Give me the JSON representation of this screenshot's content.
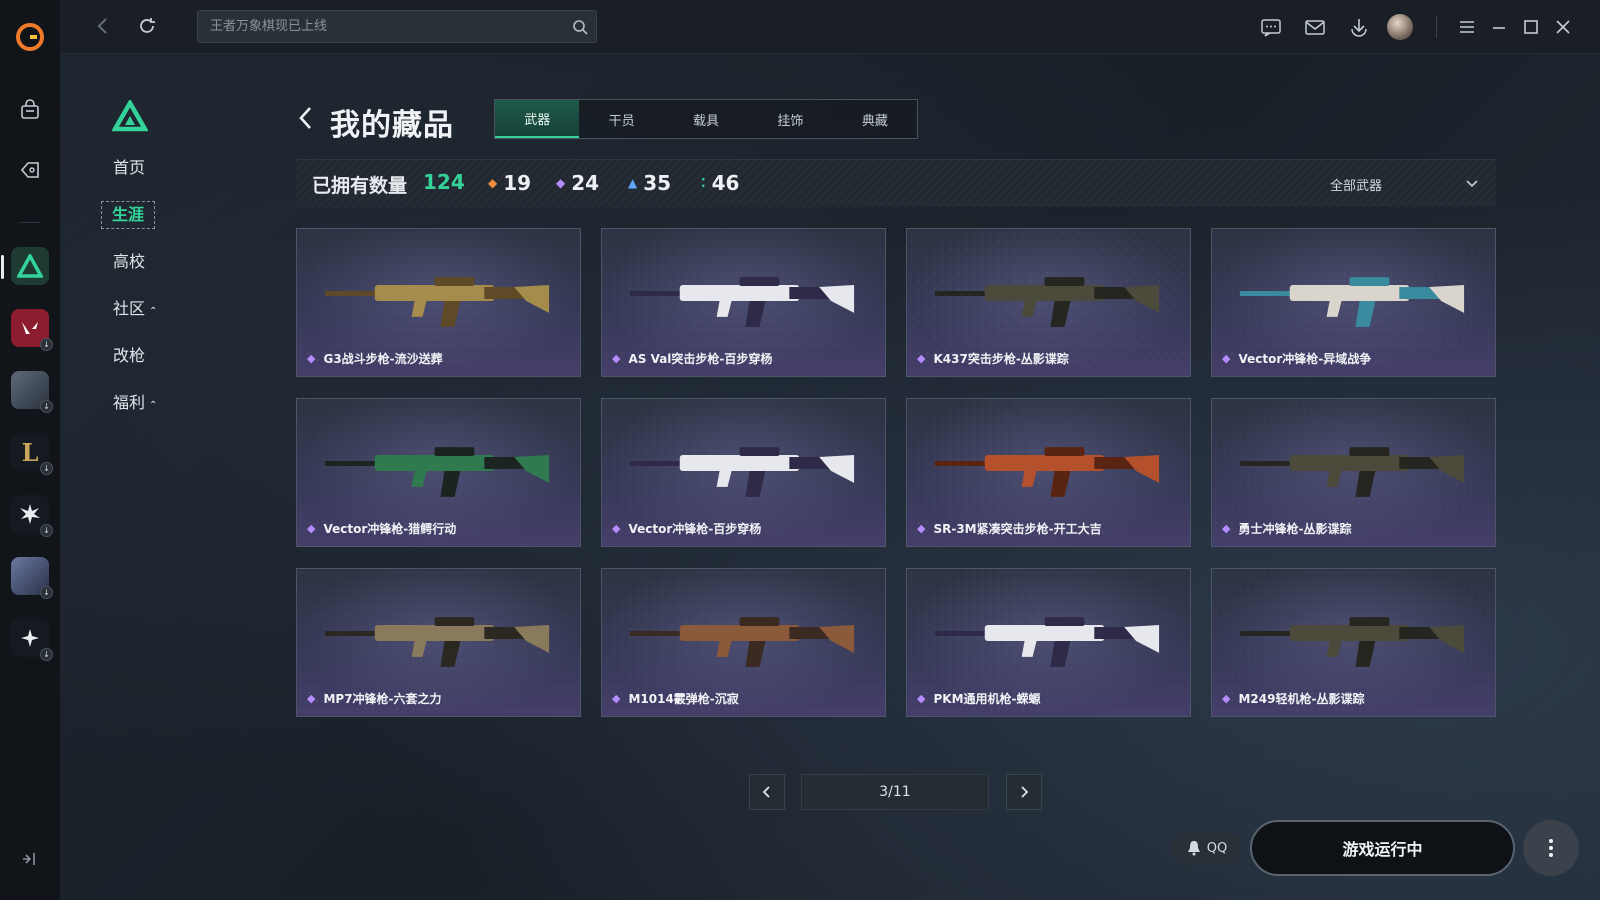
{
  "search": {
    "placeholder": "王者万象棋现已上线"
  },
  "subnav": {
    "items": [
      {
        "label": "首页",
        "caret": ""
      },
      {
        "label": "生涯",
        "caret": ""
      },
      {
        "label": "高校",
        "caret": ""
      },
      {
        "label": "社区",
        "caret": "⌃"
      },
      {
        "label": "改枪",
        "caret": ""
      },
      {
        "label": "福利",
        "caret": "⌃"
      }
    ]
  },
  "header": {
    "title": "我的藏品",
    "tabs": [
      "武器",
      "干员",
      "载具",
      "挂饰",
      "典藏"
    ]
  },
  "stats": {
    "owned_label": "已拥有数量",
    "owned_count": "124",
    "rarities": [
      {
        "value": "19",
        "color": "#f08a3c"
      },
      {
        "value": "24",
        "color": "#b58cff"
      },
      {
        "value": "35",
        "color": "#5ea8ff"
      },
      {
        "value": "46",
        "color": "#34d399"
      }
    ],
    "filter_label": "全部武器"
  },
  "items": [
    {
      "name": "G3战斗步枪-流沙送葬",
      "scheme": "gold"
    },
    {
      "name": "AS Val突击步枪-百步穿杨",
      "scheme": "white"
    },
    {
      "name": "K437突击步枪-丛影谍踪",
      "scheme": "camo"
    },
    {
      "name": "Vector冲锋枪-异域战争",
      "scheme": "ornate"
    },
    {
      "name": "Vector冲锋枪-猎鳄行动",
      "scheme": "green"
    },
    {
      "name": "Vector冲锋枪-百步穿杨",
      "scheme": "white"
    },
    {
      "name": "SR-3M紧凑突击步枪-开工大吉",
      "scheme": "red"
    },
    {
      "name": "勇士冲锋枪-丛影谍踪",
      "scheme": "camo"
    },
    {
      "name": "MP7冲锋枪-六套之力",
      "scheme": "bronze"
    },
    {
      "name": "M1014霰弹枪-沉寂",
      "scheme": "wood"
    },
    {
      "name": "PKM通用机枪-蝾螈",
      "scheme": "white"
    },
    {
      "name": "M249轻机枪-丛影谍踪",
      "scheme": "camo"
    }
  ],
  "pagination": {
    "page": "3/11"
  },
  "bottom": {
    "qq_label": "QQ",
    "run_label": "游戏运行中"
  },
  "colors": {
    "accent": "#34d399",
    "gem": "#b58cff"
  }
}
